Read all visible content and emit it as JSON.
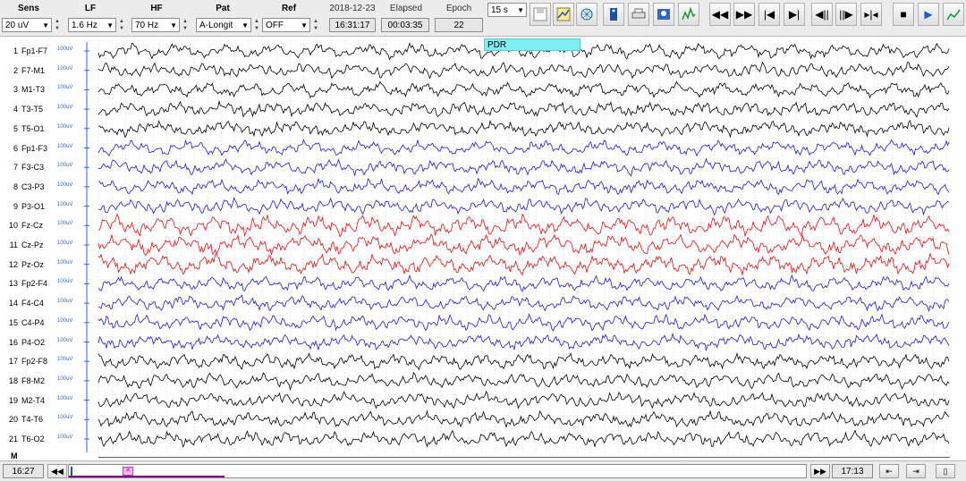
{
  "toolbar": {
    "sens": {
      "label": "Sens",
      "value": "20 uV"
    },
    "lf": {
      "label": "LF",
      "value": "1.6 Hz"
    },
    "hf": {
      "label": "HF",
      "value": "70 Hz"
    },
    "pat": {
      "label": "Pat",
      "value": "A-Longit"
    },
    "ref": {
      "label": "Ref",
      "value": "OFF"
    },
    "date": "2018-12-23",
    "time": "16:31:17",
    "elapsed_label": "Elapsed",
    "elapsed": "00:03:35",
    "epoch_label": "Epoch",
    "epoch": "22",
    "page_duration": "15 s",
    "icons": [
      "save-icon",
      "montage-icon",
      "globe-grid-icon",
      "patient-info-icon",
      "print-icon",
      "photo-icon",
      "spectrum-icon",
      "fast-rewind-icon",
      "fast-forward-icon",
      "skip-start-icon",
      "skip-end-icon",
      "step-back-icon",
      "step-forward-icon",
      "collapse-icon",
      "stop-icon",
      "play-icon",
      "chart-icon"
    ]
  },
  "channels": [
    {
      "num": "1",
      "name": "Fp1-F7",
      "color": "#000000"
    },
    {
      "num": "2",
      "name": "F7-M1",
      "color": "#000000"
    },
    {
      "num": "3",
      "name": "M1-T3",
      "color": "#000000"
    },
    {
      "num": "4",
      "name": "T3-T5",
      "color": "#000000"
    },
    {
      "num": "5",
      "name": "T5-O1",
      "color": "#000000"
    },
    {
      "num": "6",
      "name": "Fp1-F3",
      "color": "#1a1ad2"
    },
    {
      "num": "7",
      "name": "F3-C3",
      "color": "#1a1ad2"
    },
    {
      "num": "8",
      "name": "C3-P3",
      "color": "#1a1ad2"
    },
    {
      "num": "9",
      "name": "P3-O1",
      "color": "#1a1ad2"
    },
    {
      "num": "10",
      "name": "Fz-Cz",
      "color": "#e01010"
    },
    {
      "num": "11",
      "name": "Cz-Pz",
      "color": "#e01010"
    },
    {
      "num": "12",
      "name": "Pz-Oz",
      "color": "#e01010"
    },
    {
      "num": "13",
      "name": "Fp2-F4",
      "color": "#1a1ad2"
    },
    {
      "num": "14",
      "name": "F4-C4",
      "color": "#1a1ad2"
    },
    {
      "num": "15",
      "name": "C4-P4",
      "color": "#1a1ad2"
    },
    {
      "num": "16",
      "name": "P4-O2",
      "color": "#1a1ad2"
    },
    {
      "num": "17",
      "name": "Fp2-F8",
      "color": "#000000"
    },
    {
      "num": "18",
      "name": "F8-M2",
      "color": "#000000"
    },
    {
      "num": "19",
      "name": "M2-T4",
      "color": "#000000"
    },
    {
      "num": "20",
      "name": "T4-T6",
      "color": "#000000"
    },
    {
      "num": "21",
      "name": "T6-O2",
      "color": "#000000"
    }
  ],
  "marker_channel": "M",
  "scale_label": "100uV",
  "annotation": "PDR",
  "bottom": {
    "start_time": "16:27",
    "end_time": "17:13"
  }
}
